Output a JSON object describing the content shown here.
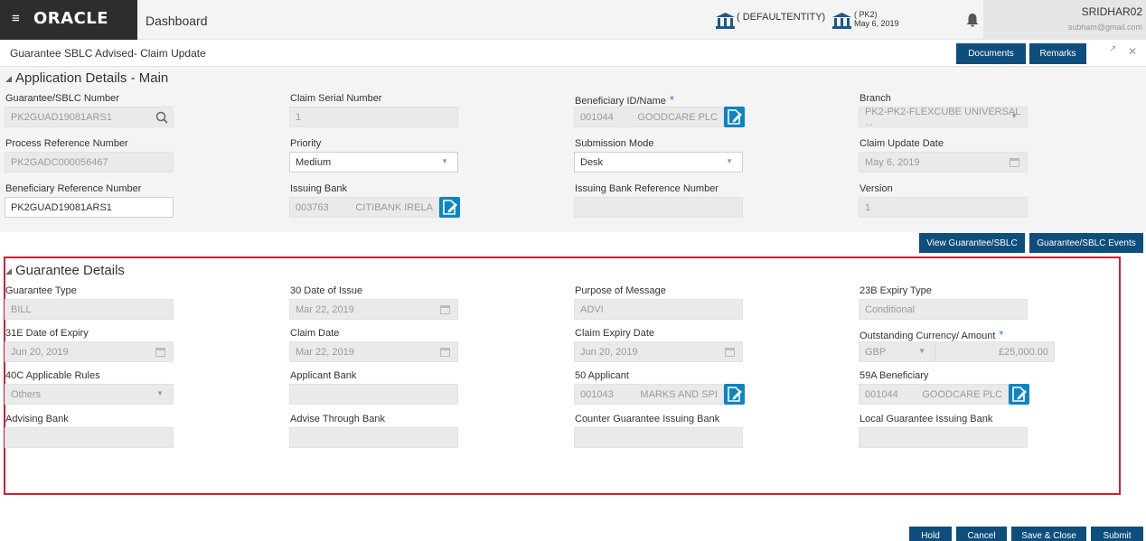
{
  "topbar": {
    "brand": "ORACLE",
    "menu_icon": "hamburger-icon",
    "title": "Dashboard",
    "entity1": "( DEFAULTENTITY)",
    "entity2_code": "( PK2)",
    "entity2_date": "May 6, 2019",
    "user": "SRIDHAR02",
    "email": "subham@gmail.com"
  },
  "header": {
    "page_title": "Guarantee SBLC Advised- Claim Update",
    "documents": "Documents",
    "remarks": "Remarks"
  },
  "app": {
    "title": "Application Details - Main",
    "guarantee_label": "Guarantee/SBLC Number",
    "guarantee_value": "PK2GUAD19081ARS1",
    "claim_serial_label": "Claim Serial Number",
    "claim_serial_value": "1",
    "beneficiary_label": "Beneficiary ID/Name",
    "beneficiary_id": "001044",
    "beneficiary_name": "GOODCARE PLC",
    "branch_label": "Branch",
    "branch_value": "PK2-PK2-FLEXCUBE UNIVERSAL ...",
    "process_ref_label": "Process Reference Number",
    "process_ref_value": "PK2GADC000056467",
    "priority_label": "Priority",
    "priority_value": "Medium",
    "submission_label": "Submission Mode",
    "submission_value": "Desk",
    "claim_update_label": "Claim Update Date",
    "claim_update_value": "May 6, 2019",
    "ben_ref_label": "Beneficiary Reference Number",
    "ben_ref_value": "PK2GUAD19081ARS1",
    "issuing_bank_label": "Issuing Bank",
    "issuing_bank_id": "003763",
    "issuing_bank_name": "CITIBANK IRELA",
    "issuing_ref_label": "Issuing Bank Reference Number",
    "issuing_ref_value": "",
    "version_label": "Version",
    "version_value": "1"
  },
  "actions": {
    "view": "View Guarantee/SBLC",
    "events": "Guarantee/SBLC Events"
  },
  "gd": {
    "title": "Guarantee Details",
    "type_label": "Guarantee Type",
    "type_value": "BILL",
    "issue_label": "30 Date of Issue",
    "issue_value": "Mar 22, 2019",
    "purpose_label": "Purpose of Message",
    "purpose_value": "ADVI",
    "expiry_type_label": "23B Expiry Type",
    "expiry_type_value": "Conditional",
    "expiry_label": "31E Date of Expiry",
    "expiry_value": "Jun 20, 2019",
    "claim_date_label": "Claim Date",
    "claim_date_value": "Mar 22, 2019",
    "claim_expiry_label": "Claim Expiry Date",
    "claim_expiry_value": "Jun 20, 2019",
    "outstanding_label": "Outstanding Currency/ Amount",
    "currency_value": "GBP",
    "amount_value": "£25,000.00",
    "rules_label": "40C Applicable Rules",
    "rules_value": "Others",
    "applicant_bank_label": "Applicant Bank",
    "applicant_bank_value": "",
    "applicant_label": "50 Applicant",
    "applicant_id": "001043",
    "applicant_name": "MARKS AND SPI",
    "beneficiary_label": "59A Beneficiary",
    "beneficiary_id": "001044",
    "beneficiary_name": "GOODCARE PLC",
    "advising_label": "Advising Bank",
    "advise_through_label": "Advise Through Bank",
    "counter_label": "Counter Guarantee Issuing Bank",
    "local_label": "Local Guarantee Issuing Bank"
  },
  "footer": {
    "hold": "Hold",
    "cancel": "Cancel",
    "save_close": "Save & Close",
    "submit": "Submit"
  },
  "colors": {
    "button": "#0e4e7d",
    "doc_button": "#0e84c4",
    "highlight_border": "#d02030",
    "required": "#2f7bd1"
  }
}
